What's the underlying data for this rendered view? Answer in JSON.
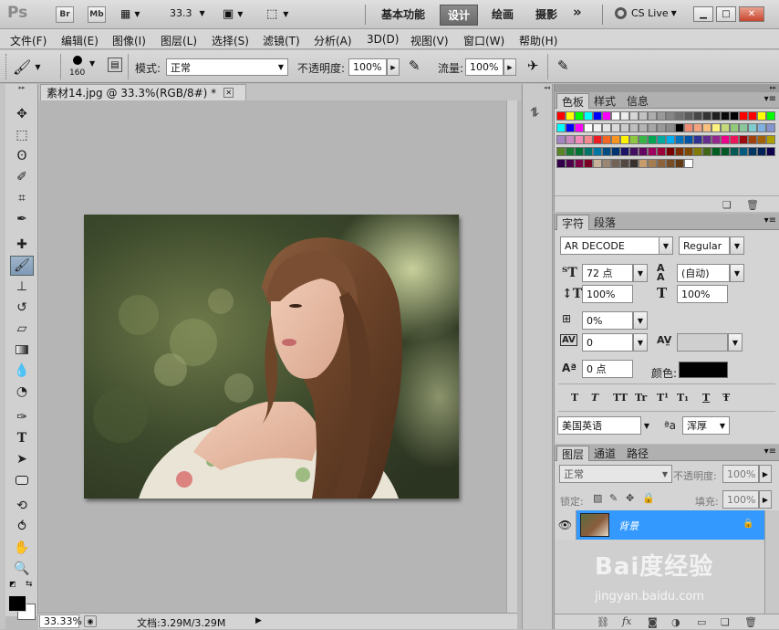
{
  "app": {
    "logo": "Ps",
    "bridge": "Br",
    "minibridge": "Mb",
    "zoom": "33.3",
    "workspaces": [
      "基本功能",
      "设计",
      "绘画",
      "摄影"
    ],
    "active_workspace": "设计",
    "more": "»",
    "cslive": "CS Live"
  },
  "menu": [
    "文件(F)",
    "编辑(E)",
    "图像(I)",
    "图层(L)",
    "选择(S)",
    "滤镜(T)",
    "分析(A)",
    "3D(D)",
    "视图(V)",
    "窗口(W)",
    "帮助(H)"
  ],
  "options": {
    "brush_size": "160",
    "mode_label": "模式:",
    "mode_value": "正常",
    "opacity_label": "不透明度:",
    "opacity_value": "100%",
    "flow_label": "流量:",
    "flow_value": "100%"
  },
  "document": {
    "tab_title": "素材14.jpg @ 33.3%(RGB/8#) *",
    "status_zoom": "33.33%",
    "status_doc": "文档:3.29M/3.29M"
  },
  "swatches_panel": {
    "tabs": [
      "色板",
      "样式",
      "信息"
    ],
    "rows": [
      [
        "#ff0000",
        "#ffff00",
        "#00ff00",
        "#00ffff",
        "#0000ff",
        "#ff00ff",
        "#ffffff",
        "#ebebeb",
        "#d6d6d6",
        "#c2c2c2",
        "#adadad",
        "#999999",
        "#858585",
        "#707070",
        "#5c5c5c",
        "#474747",
        "#333333",
        "#1f1f1f",
        "#0a0a0a",
        "#000000",
        "#ff0000",
        "#ff0000",
        "#ffff00",
        "#00ff00"
      ],
      [
        "#00ffff",
        "#0000ff",
        "#ff00ff",
        "#ffffff",
        "#f2f2f2",
        "#e6e6e6",
        "#d9d9d9",
        "#cccccc",
        "#bfbfbf",
        "#b3b3b3",
        "#a6a6a6",
        "#999999",
        "#8c8c8c",
        "#000000",
        "#ed8b73",
        "#f4a27f",
        "#fac07f",
        "#fdf27f",
        "#c3db7c",
        "#92c97c",
        "#8ac59b",
        "#7fcdcf",
        "#7fb2e0",
        "#8494cd"
      ],
      [
        "#a485c1",
        "#c88ac1",
        "#f08cb8",
        "#f08b8d",
        "#ed1c24",
        "#f26522",
        "#f7941d",
        "#fff200",
        "#8dc63f",
        "#39b54a",
        "#00a651",
        "#00a99d",
        "#00aeef",
        "#0072bc",
        "#0054a6",
        "#2e3192",
        "#662d91",
        "#92278f",
        "#ec008c",
        "#ed145b",
        "#9e0b0f",
        "#a0410d",
        "#a3620a",
        "#aba000"
      ],
      [
        "#598527",
        "#1a7b30",
        "#007236",
        "#00746b",
        "#0076a3",
        "#004b80",
        "#003471",
        "#1b1464",
        "#440e62",
        "#630460",
        "#9e005d",
        "#9e0039",
        "#790000",
        "#7b2e00",
        "#7d4900",
        "#827b00",
        "#406618",
        "#005e20",
        "#005826",
        "#005952",
        "#005b7f",
        "#003663",
        "#002157",
        "#0d004c"
      ],
      [
        "#32004b",
        "#4b0049",
        "#7b0046",
        "#7a0026",
        "#c7b299",
        "#998675",
        "#736357",
        "#534741",
        "#37302d",
        "#c69c6d",
        "#a67c52",
        "#8c6239",
        "#754c24",
        "#603913",
        "#ffffff"
      ]
    ]
  },
  "char_panel": {
    "tabs": [
      "字符",
      "段落"
    ],
    "font_family": "AR DECODE",
    "font_style": "Regular",
    "size": "72 点",
    "leading": "(自动)",
    "vscale": "100%",
    "hscale": "100%",
    "tracking_pct": "0%",
    "kerning": "0",
    "baseline": "0 点",
    "color_label": "颜色:",
    "color": "#000000",
    "style_buttons": [
      "T",
      "T",
      "TT",
      "Tr",
      "T¹",
      "T₁",
      "T",
      "Ŧ"
    ],
    "language": "美国英语",
    "aa_label": "ªa",
    "antialias": "浑厚"
  },
  "layers_panel": {
    "tabs": [
      "图层",
      "通道",
      "路径"
    ],
    "blend": "正常",
    "opacity_label": "不透明度:",
    "opacity": "100%",
    "lock_label": "锁定:",
    "fill_label": "填充:",
    "fill": "100%",
    "layer_name": "背景"
  },
  "watermark": {
    "brand": "Bai度经验",
    "url": "jingyan.baidu.com"
  },
  "colors": {
    "accent": "#3399ff",
    "foreground": "#000000",
    "background": "#ffffff"
  }
}
